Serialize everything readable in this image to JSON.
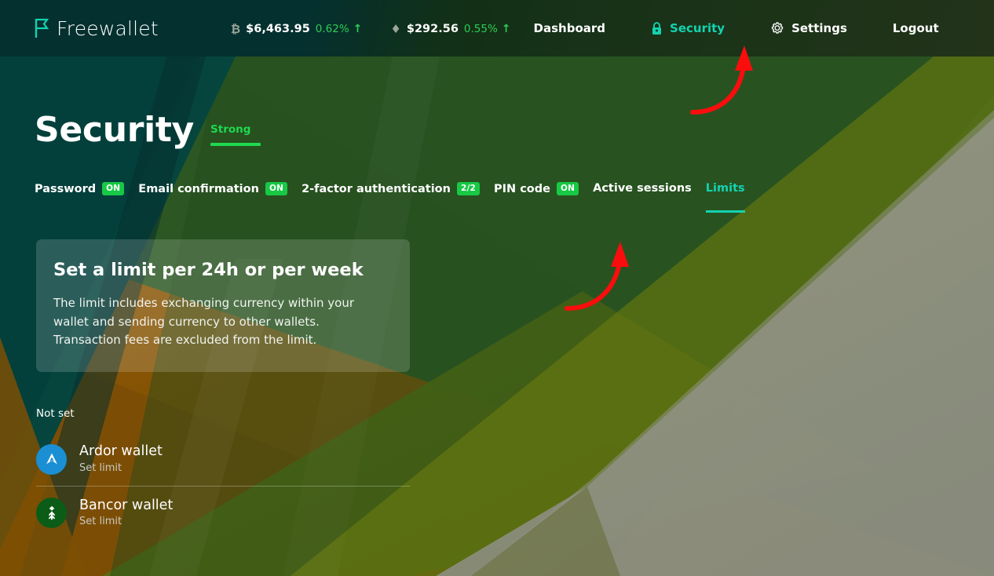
{
  "header": {
    "brand": {
      "name": "Freewallet",
      "logo_icon": "flag-f-logo-icon",
      "logo_color": "#13d3b0"
    },
    "tickers": [
      {
        "symbol": "₿",
        "symbol_name": "bitcoin-icon",
        "price": "$6,463.95",
        "change": "0.62%",
        "direction": "↑"
      },
      {
        "symbol": "♦",
        "symbol_name": "ethereum-icon",
        "price": "$292.56",
        "change": "0.55%",
        "direction": "↑"
      }
    ],
    "nav": [
      {
        "label": "Dashboard",
        "icon": "",
        "active": false
      },
      {
        "label": "Security",
        "icon": "lock-icon",
        "active": true
      },
      {
        "label": "Settings",
        "icon": "gear-icon",
        "active": false
      },
      {
        "label": "Logout",
        "icon": "",
        "active": false
      }
    ]
  },
  "page": {
    "title": "Security",
    "strength": "Strong"
  },
  "tabs": [
    {
      "label": "Password",
      "badge": "ON",
      "active": false
    },
    {
      "label": "Email confirmation",
      "badge": "ON",
      "active": false
    },
    {
      "label": "2-factor authentication",
      "badge": "2/2",
      "active": false
    },
    {
      "label": "PIN code",
      "badge": "ON",
      "active": false
    },
    {
      "label": "Active sessions",
      "badge": "",
      "active": false
    },
    {
      "label": "Limits",
      "badge": "",
      "active": true
    }
  ],
  "info_card": {
    "title": "Set a limit per 24h or per week",
    "text": "The limit includes exchanging currency within your wallet and sending currency to other wallets. Transaction fees are excluded from the limit."
  },
  "limits": {
    "section_label": "Not set",
    "wallets": [
      {
        "name": "Ardor wallet",
        "action": "Set limit",
        "icon": "ardor-coin-icon",
        "color": "#1a8fd4"
      },
      {
        "name": "Bancor wallet",
        "action": "Set limit",
        "icon": "bancor-coin-icon",
        "color": "#0b5c17"
      }
    ]
  },
  "annotations": {
    "arrow_color": "#fb0d0d",
    "arrows": [
      {
        "name": "arrow-to-security-nav"
      },
      {
        "name": "arrow-to-limits-tab"
      }
    ]
  },
  "colors": {
    "accent_teal": "#13d3b0",
    "accent_green": "#1ed94f",
    "badge_green": "#17c944"
  }
}
